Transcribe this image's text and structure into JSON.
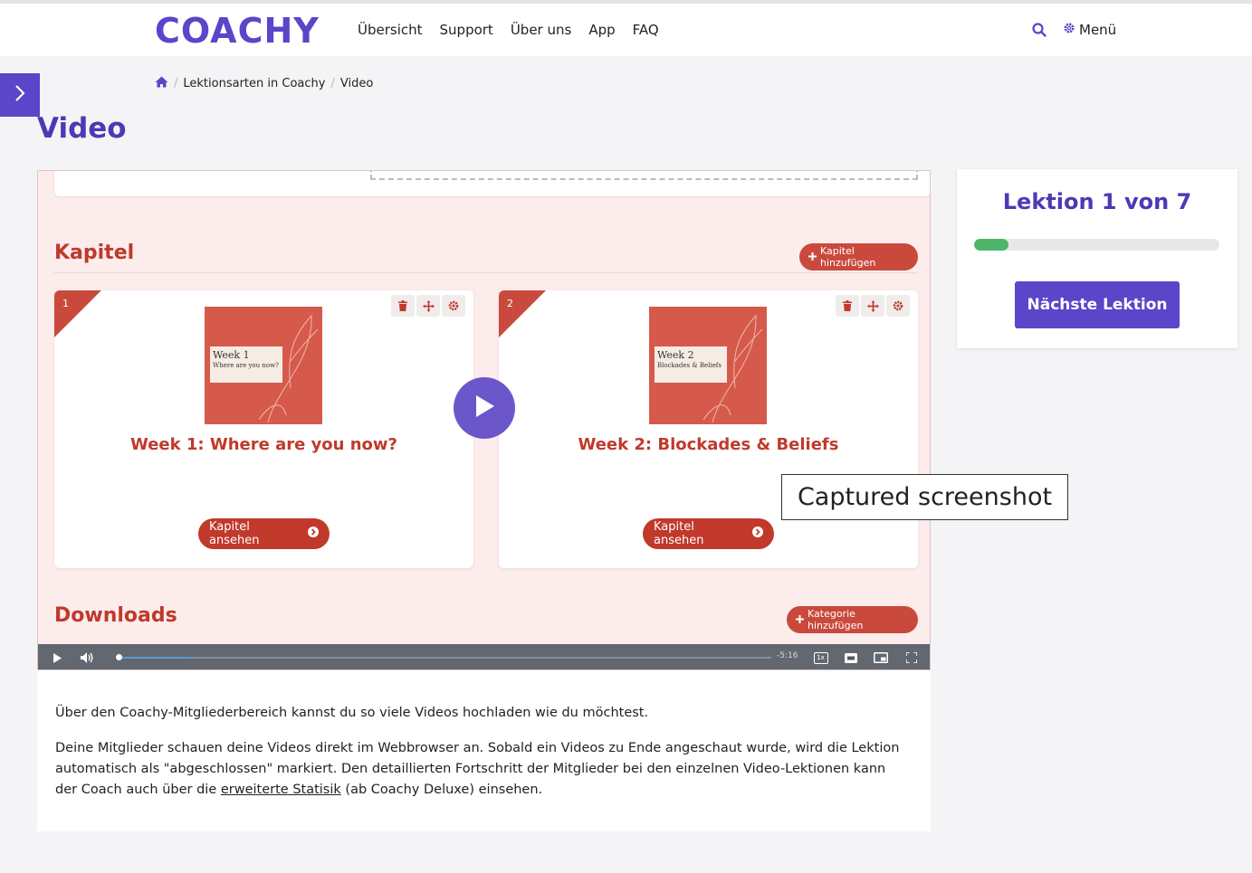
{
  "header": {
    "logo_text": "COACHY",
    "nav": [
      "Übersicht",
      "Support",
      "Über uns",
      "App",
      "FAQ"
    ],
    "menu_label": "Menü"
  },
  "breadcrumb": {
    "items": [
      "Lektionsarten in Coachy",
      "Video"
    ]
  },
  "page": {
    "title": "Video"
  },
  "video": {
    "sections": {
      "chapters_heading": "Kapitel",
      "chapters_add": "Kapitel hinzufügen",
      "downloads_heading": "Downloads",
      "downloads_add": "Kategorie hinzufügen"
    },
    "chapters": [
      {
        "number": "1",
        "thumb_week": "Week 1",
        "thumb_sub": "Where are you now?",
        "title": "Week 1: Where are you now?",
        "button": "Kapitel ansehen"
      },
      {
        "number": "2",
        "thumb_week": "Week 2",
        "thumb_sub": "Blockades & Beliefs",
        "title": "Week 2: Blockades & Beliefs",
        "button": "Kapitel ansehen"
      }
    ],
    "player": {
      "time_remaining": "-5:16",
      "speed": "1x",
      "progress": 0.11,
      "buffered": 0.11
    }
  },
  "description": {
    "p1": "Über den Coachy-Mitgliederbereich kannst du so viele Videos hochladen wie du möchtest.",
    "p2_start": "Deine Mitglieder schauen deine Videos direkt im Webbrowser an. Sobald ein Videos zu Ende angeschaut wurde, wird die Lektion automatisch als \"abgeschlossen\" markiert. Den detaillierten Fortschritt der Mitglieder bei den einzelnen Video-Lektionen kann der Coach auch über die ",
    "p2_link": "erweiterte Statisik",
    "p2_end": " (ab Coachy Deluxe) einsehen."
  },
  "sidebar": {
    "lesson_label": "Lektion 1 von 7",
    "progress": 0.14,
    "next_button": "Nächste Lektion"
  },
  "tooltip": {
    "text": "Captured screenshot"
  },
  "colors": {
    "brand": "#5b45c9",
    "accent_red": "#c0392b",
    "progress_green": "#4cb56a"
  }
}
